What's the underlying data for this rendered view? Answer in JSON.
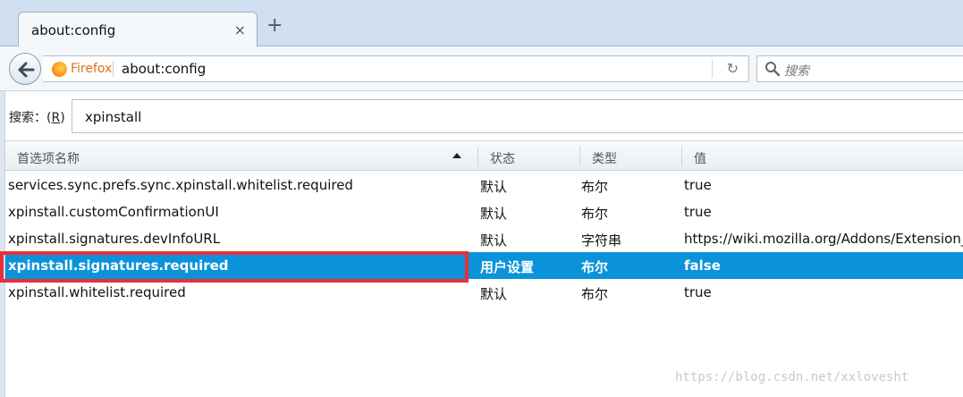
{
  "tab": {
    "title": "about:config",
    "close": "×",
    "new_tab": "+"
  },
  "navbar": {
    "brand": "Firefox",
    "url": "about:config",
    "reload_icon": "↻",
    "search_placeholder": "搜索"
  },
  "filter": {
    "label_prefix": "搜索：(",
    "label_key": "R",
    "label_suffix": ")",
    "value": "xpinstall"
  },
  "table": {
    "headers": {
      "name": "首选项名称",
      "status": "状态",
      "type": "类型",
      "value": "值"
    },
    "rows": [
      {
        "name": "services.sync.prefs.sync.xpinstall.whitelist.required",
        "status": "默认",
        "type": "布尔",
        "value": "true"
      },
      {
        "name": "xpinstall.customConfirmationUI",
        "status": "默认",
        "type": "布尔",
        "value": "true"
      },
      {
        "name": "xpinstall.signatures.devInfoURL",
        "status": "默认",
        "type": "字符串",
        "value": "https://wiki.mozilla.org/Addons/Extension_"
      },
      {
        "name": "xpinstall.signatures.required",
        "status": "用户设置",
        "type": "布尔",
        "value": "false",
        "selected": true
      },
      {
        "name": "xpinstall.whitelist.required",
        "status": "默认",
        "type": "布尔",
        "value": "true"
      }
    ]
  },
  "colors": {
    "selection": "#0a93d9",
    "highlight_border": "#e8303a",
    "brand": "#e2701a"
  },
  "watermark": "https://blog.csdn.net/xxlovesht"
}
